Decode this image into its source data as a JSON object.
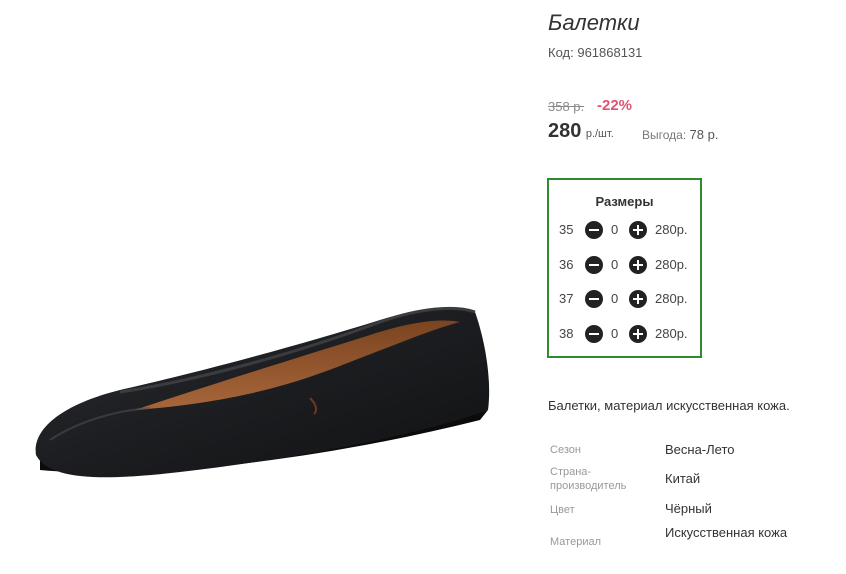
{
  "product": {
    "title": "Балетки",
    "code_label": "Код:",
    "code": "961868131",
    "old_price": "358 р.",
    "discount": "-22%",
    "price": "280",
    "price_unit": "р./шт.",
    "savings_label": "Выгода:",
    "savings_value": "78 р.",
    "description": "Балетки, материал искусственная кожа."
  },
  "sizes": {
    "title": "Размеры",
    "rows": [
      {
        "size": "35",
        "qty": "0",
        "price": "280р."
      },
      {
        "size": "36",
        "qty": "0",
        "price": "280р."
      },
      {
        "size": "37",
        "qty": "0",
        "price": "280р."
      },
      {
        "size": "38",
        "qty": "0",
        "price": "280р."
      }
    ]
  },
  "attributes": [
    {
      "label": "Сезон",
      "value": "Весна-Лето"
    },
    {
      "label_line1": "Страна-",
      "label_line2": "производитель",
      "value": "Китай"
    },
    {
      "label": "Цвет",
      "value": "Чёрный"
    },
    {
      "label": "Материал",
      "value": "Искусственная кожа"
    }
  ],
  "colors": {
    "accent_border": "#2e8b2e",
    "discount": "#e05470"
  },
  "icons": {
    "minus": "minus-circle-icon",
    "plus": "plus-circle-icon"
  }
}
